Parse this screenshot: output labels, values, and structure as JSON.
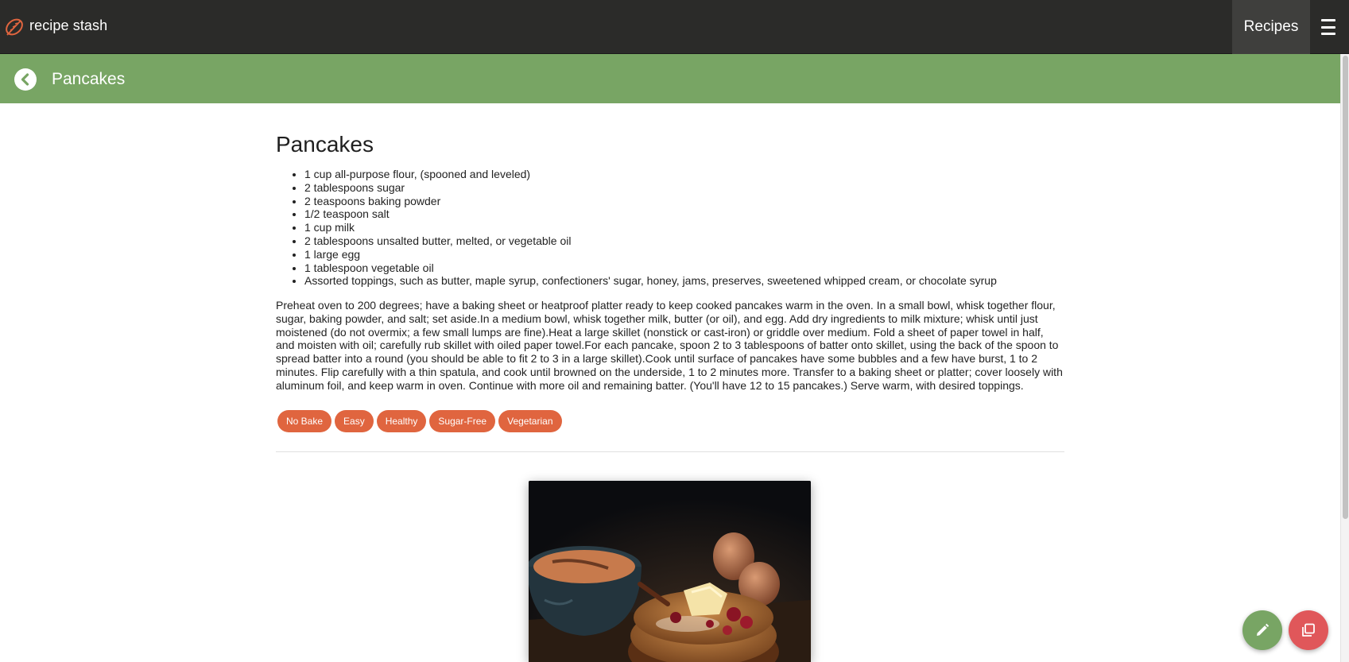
{
  "app": {
    "brand": "recipe stash",
    "nav_recipes": "Recipes"
  },
  "subheader": {
    "title": "Pancakes"
  },
  "recipe": {
    "title": "Pancakes",
    "ingredients": [
      "1 cup all-purpose flour, (spooned and leveled)",
      "2 tablespoons sugar",
      "2 teaspoons baking powder",
      "1/2 teaspoon salt",
      "1 cup milk",
      "2 tablespoons unsalted butter, melted, or vegetable oil",
      "1 large egg",
      "1 tablespoon vegetable oil",
      "Assorted toppings, such as butter, maple syrup, confectioners' sugar, honey, jams, preserves, sweetened whipped cream, or chocolate syrup"
    ],
    "directions": "Preheat oven to 200 degrees; have a baking sheet or heatproof platter ready to keep cooked pancakes warm in the oven. In a small bowl, whisk together flour, sugar, baking powder, and salt; set aside.In a medium bowl, whisk together milk, butter (or oil), and egg. Add dry ingredients to milk mixture; whisk until just moistened (do not overmix; a few small lumps are fine).Heat a large skillet (nonstick or cast-iron) or griddle over medium. Fold a sheet of paper towel in half, and moisten with oil; carefully rub skillet with oiled paper towel.For each pancake, spoon 2 to 3 tablespoons of batter onto skillet, using the back of the spoon to spread batter into a round (you should be able to fit 2 to 3 in a large skillet).Cook until surface of pancakes have some bubbles and a few have burst, 1 to 2 minutes. Flip carefully with a thin spatula, and cook until browned on the underside, 1 to 2 minutes more. Transfer to a baking sheet or platter; cover loosely with aluminum foil, and keep warm in oven. Continue with more oil and remaining batter. (You'll have 12 to 15 pancakes.) Serve warm, with desired toppings.",
    "tags": [
      "No Bake",
      "Easy",
      "Healthy",
      "Sugar-Free",
      "Vegetarian"
    ]
  },
  "icons": {
    "logo": "leaf-logo-icon",
    "menu": "hamburger-menu-icon",
    "back": "chevron-left-circle-icon",
    "edit": "pencil-icon",
    "copy": "copy-icon"
  },
  "colors": {
    "topbar": "#2b2b29",
    "subbar": "#78a564",
    "tag": "#e0653f",
    "fab_edit": "#78a564",
    "fab_copy": "#e0575a",
    "logo": "#e0653f"
  }
}
